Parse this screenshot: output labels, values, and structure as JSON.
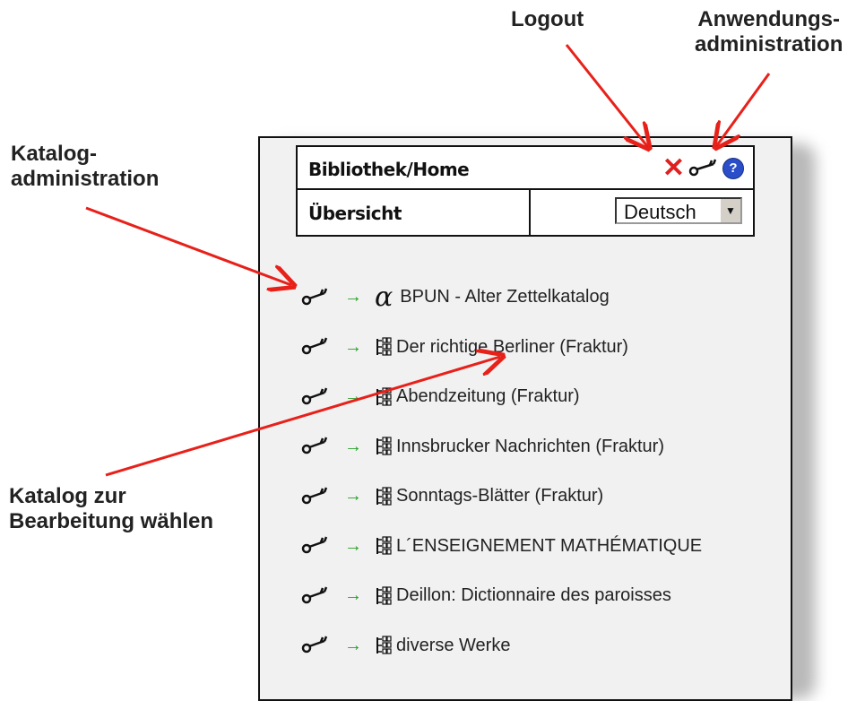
{
  "annotations": {
    "logout": "Logout",
    "app_admin_line1": "Anwendungs-",
    "app_admin_line2": "administration",
    "catalog_admin_line1": "Katalog-",
    "catalog_admin_line2": "administration",
    "select_catalog_line1": "Katalog zur",
    "select_catalog_line2": "Bearbeitung wählen"
  },
  "header": {
    "title": "Bibliothek/Home",
    "overview": "Übersicht",
    "language_select": {
      "value": "Deutsch"
    },
    "icons": [
      "logout-icon",
      "app-admin-key-icon",
      "help-icon"
    ],
    "help_glyph": "?"
  },
  "catalogs": [
    {
      "label": "BPUN - Alter Zettelkatalog",
      "type_glyph": "α",
      "icon": "alpha-icon"
    },
    {
      "label": "Der richtige Berliner (Fraktur)",
      "icon": "tree-icon"
    },
    {
      "label": "Abendzeitung (Fraktur)",
      "icon": "tree-icon"
    },
    {
      "label": "Innsbrucker Nachrichten (Fraktur)",
      "icon": "tree-icon"
    },
    {
      "label": "Sonntags-Blätter (Fraktur)",
      "icon": "tree-icon"
    },
    {
      "label": "L´ENSEIGNEMENT MATHÉMATIQUE",
      "icon": "tree-icon"
    },
    {
      "label": "Deillon: Dictionnaire des paroisses",
      "icon": "tree-icon"
    },
    {
      "label": "diverse Werke",
      "icon": "tree-icon"
    }
  ],
  "colors": {
    "arrow": "#e8201a",
    "go_arrow": "#2aa02a",
    "help": "#2a4ec9",
    "logout": "#e02020"
  }
}
